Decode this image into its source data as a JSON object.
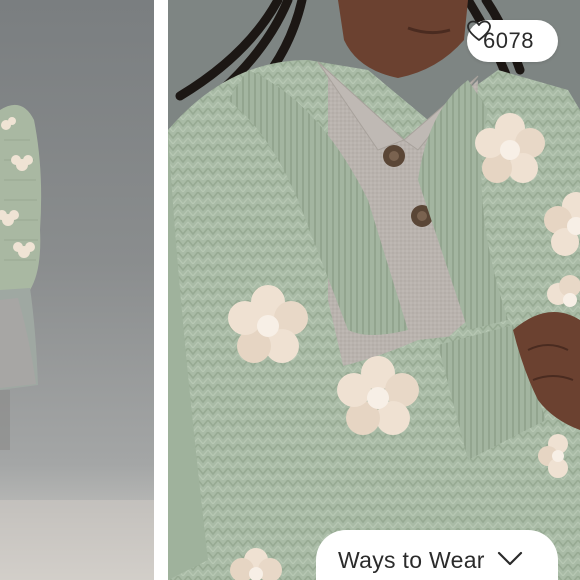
{
  "gallery": {
    "likes": {
      "count": "6078",
      "icon": "heart-outline-icon"
    },
    "ways_to_wear": {
      "label": "Ways to Wear",
      "icon": "chevron-down-icon"
    }
  },
  "colors": {
    "sweater_sage": "#a9bba6",
    "flower_cream": "#efe1d2",
    "polo_grey": "#b9b3ae",
    "button_brown": "#5a4636",
    "skin": "#6b4130"
  }
}
